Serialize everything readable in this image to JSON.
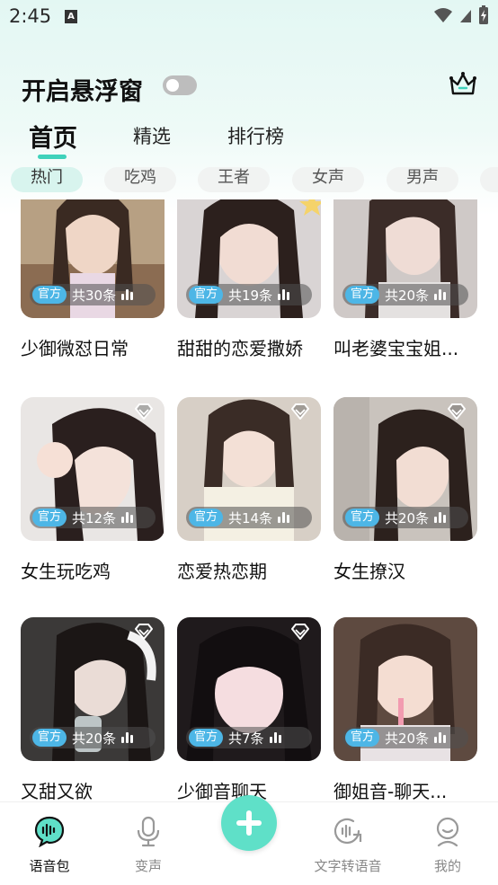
{
  "status_bar": {
    "time": "2:45"
  },
  "header": {
    "float_window_label": "开启悬浮窗",
    "float_window_enabled": false
  },
  "tabs": [
    {
      "label": "首页",
      "active": true
    },
    {
      "label": "精选",
      "active": false
    },
    {
      "label": "排行榜",
      "active": false
    }
  ],
  "chips": [
    {
      "label": "热门",
      "active": true
    },
    {
      "label": "吃鸡",
      "active": false
    },
    {
      "label": "王者",
      "active": false
    },
    {
      "label": "女声",
      "active": false
    },
    {
      "label": "男声",
      "active": false
    }
  ],
  "cards": [
    {
      "title": "少御微怼日常",
      "badge": "官方",
      "count": "共30条",
      "vip": false
    },
    {
      "title": "甜甜的恋爱撒娇",
      "badge": "官方",
      "count": "共19条",
      "vip": false
    },
    {
      "title": "叫老婆宝宝姐...",
      "badge": "官方",
      "count": "共20条",
      "vip": false
    },
    {
      "title": "女生玩吃鸡",
      "badge": "官方",
      "count": "共12条",
      "vip": true
    },
    {
      "title": "恋爱热恋期",
      "badge": "官方",
      "count": "共14条",
      "vip": true
    },
    {
      "title": "女生撩汉",
      "badge": "官方",
      "count": "共20条",
      "vip": true
    },
    {
      "title": "又甜又欲",
      "badge": "官方",
      "count": "共20条",
      "vip": true
    },
    {
      "title": "少御音聊天",
      "badge": "官方",
      "count": "共7条",
      "vip": true
    },
    {
      "title": "御姐音-聊天...",
      "badge": "官方",
      "count": "共20条",
      "vip": false
    }
  ],
  "bottom_nav": [
    {
      "label": "语音包",
      "icon": "voice-pack-icon",
      "active": true
    },
    {
      "label": "变声",
      "icon": "microphone-icon",
      "active": false
    },
    {
      "label": "",
      "icon": "plus-icon",
      "active": false
    },
    {
      "label": "文字转语音",
      "icon": "text-to-speech-icon",
      "active": false
    },
    {
      "label": "我的",
      "icon": "profile-icon",
      "active": false
    }
  ],
  "colors": {
    "accent": "#5fe0c8",
    "badge": "#4db6e6",
    "toggle_off": "#bdbdbd"
  }
}
